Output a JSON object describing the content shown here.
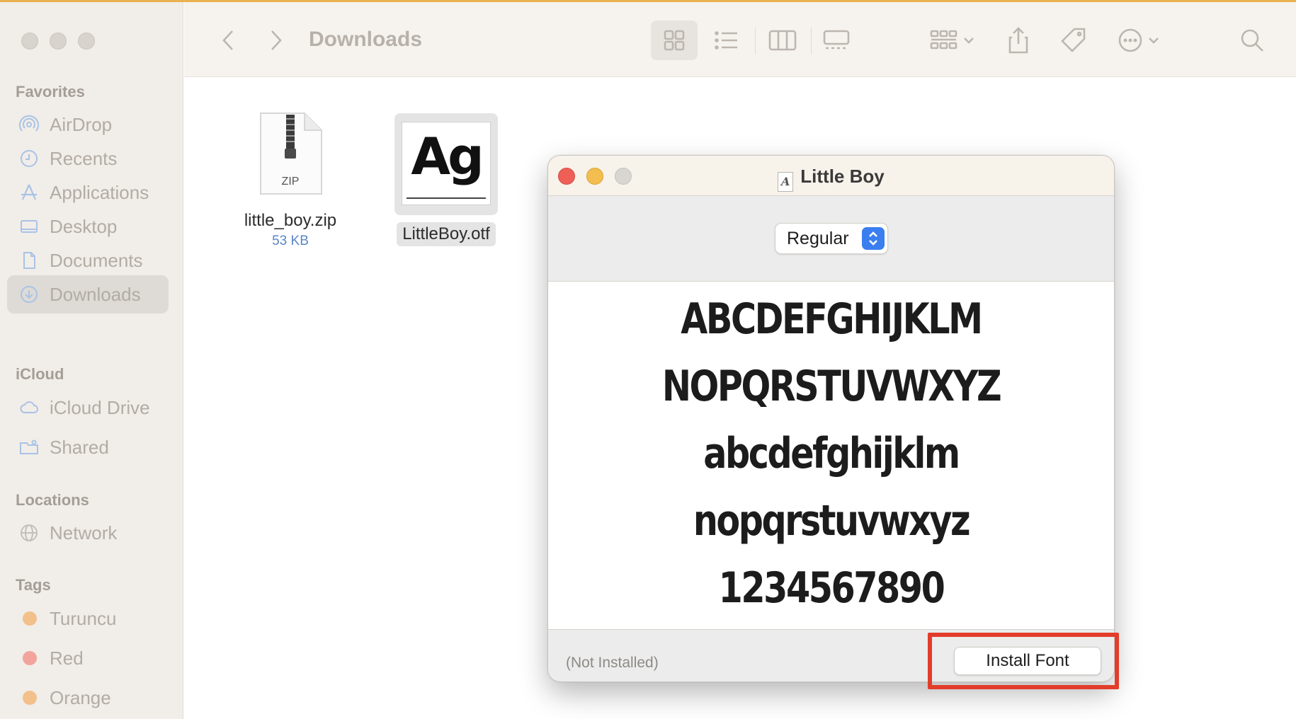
{
  "finder": {
    "title": "Downloads",
    "sidebar": {
      "favorites_heading": "Favorites",
      "favorites": [
        {
          "label": "AirDrop",
          "icon": "airdrop-icon"
        },
        {
          "label": "Recents",
          "icon": "clock-icon"
        },
        {
          "label": "Applications",
          "icon": "applications-icon"
        },
        {
          "label": "Desktop",
          "icon": "desktop-icon"
        },
        {
          "label": "Documents",
          "icon": "document-icon"
        },
        {
          "label": "Downloads",
          "icon": "download-icon",
          "active": true
        }
      ],
      "icloud_heading": "iCloud",
      "icloud": [
        {
          "label": "iCloud Drive",
          "icon": "cloud-icon"
        },
        {
          "label": "Shared",
          "icon": "shared-folder-icon"
        }
      ],
      "locations_heading": "Locations",
      "locations": [
        {
          "label": "Network",
          "icon": "globe-icon"
        }
      ],
      "tags_heading": "Tags",
      "tags": [
        {
          "label": "Turuncu",
          "color": "#f2c08a"
        },
        {
          "label": "Red",
          "color": "#f2a49c"
        },
        {
          "label": "Orange",
          "color": "#f2c08a"
        }
      ]
    },
    "files": [
      {
        "name": "little_boy.zip",
        "size": "53 KB",
        "badge": "ZIP"
      },
      {
        "name": "LittleBoy.otf",
        "preview": "Ag"
      }
    ]
  },
  "font_dialog": {
    "title": "Little Boy",
    "style_select": "Regular",
    "sample_lines": [
      "ABCDEFGHIJKLM",
      "NOPQRSTUVWXYZ",
      "abcdefghijklm",
      "nopqrstuvwxyz",
      "1234567890"
    ],
    "status": "(Not Installed)",
    "install_label": "Install Font"
  },
  "colors": {
    "accent": "#3a7ef0",
    "highlight": "#e23d2a",
    "close": "#ed5f57",
    "minimize": "#f4bd4f"
  }
}
